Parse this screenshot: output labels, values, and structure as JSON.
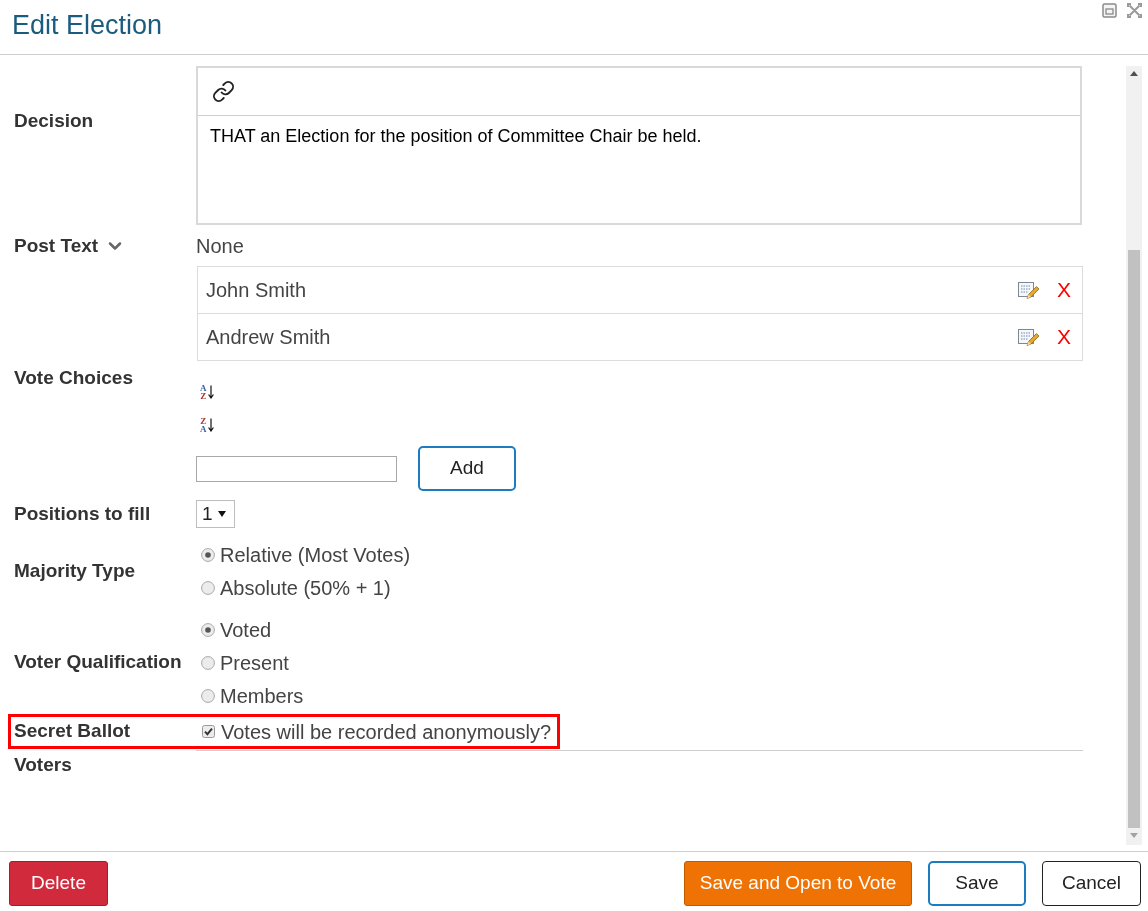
{
  "window": {
    "title": "Edit Election"
  },
  "decision": {
    "label": "Decision",
    "text": "THAT an Election for the position of Committee Chair be held."
  },
  "post_text": {
    "label": "Post Text",
    "expanded": false,
    "value": "None"
  },
  "vote_choices": {
    "label": "Vote Choices",
    "items": [
      {
        "name": "John Smith",
        "remove": "X"
      },
      {
        "name": "Andrew Smith",
        "remove": "X"
      }
    ],
    "sort_buttons": [
      {
        "kind": "ascending",
        "top": "A",
        "bottom": "Z"
      },
      {
        "kind": "descending",
        "top": "Z",
        "bottom": "A"
      }
    ],
    "add_button": "Add"
  },
  "positions_to_fill": {
    "label": "Positions to fill",
    "value": "1"
  },
  "majority_type": {
    "label": "Majority Type",
    "options": [
      {
        "label": "Relative (Most Votes)",
        "selected": true
      },
      {
        "label": "Absolute (50% + 1)",
        "selected": false
      }
    ]
  },
  "voter_qualification": {
    "label": "Voter Qualification",
    "options": [
      {
        "label": "Voted",
        "selected": true
      },
      {
        "label": "Present",
        "selected": false
      },
      {
        "label": "Members",
        "selected": false
      }
    ]
  },
  "secret_ballot": {
    "label": "Secret Ballot",
    "option": "Votes will be recorded anonymously?",
    "checked": true,
    "highlighted": true
  },
  "voters": {
    "label": "Voters"
  },
  "footer": {
    "left_buttons": [
      {
        "label": "Delete",
        "kind": "danger"
      }
    ],
    "right_buttons": [
      {
        "label": "Save and Open to Vote",
        "kind": "warning"
      },
      {
        "label": "Save",
        "kind": "primary"
      },
      {
        "label": "Cancel",
        "kind": "default"
      }
    ]
  }
}
